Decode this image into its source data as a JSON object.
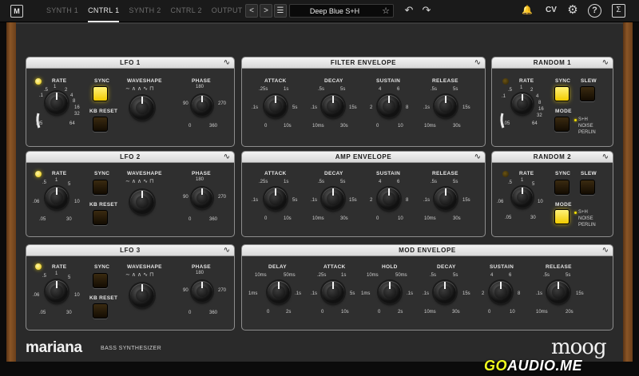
{
  "topbar": {
    "logo": "M",
    "tabs": [
      {
        "label": "SYNTH 1"
      },
      {
        "label": "CNTRL 1"
      },
      {
        "label": "SYNTH 2"
      },
      {
        "label": "CNTRL 2"
      },
      {
        "label": "OUTPUT"
      }
    ],
    "prev": "<",
    "next": ">",
    "menu": "☰",
    "preset": "Deep Blue S+H",
    "star": "☆",
    "undo": "↶",
    "redo": "↷",
    "bell": "🔔",
    "cv": "CV",
    "gear": "⚙",
    "help": "?",
    "sigma": "Σ"
  },
  "panels": {
    "lfo1": {
      "title": "LFO 1",
      "rate": "RATE",
      "sync": "SYNC",
      "waveshape": "WAVESHAPE",
      "phase": "PHASE",
      "kbreset": "KB RESET",
      "rate_ticks": [
        ".05",
        ".1",
        ".5",
        "1",
        "2",
        "4",
        "8",
        "16",
        "32",
        "64"
      ],
      "phase_ticks": [
        "0",
        "90",
        "180",
        "270",
        "360"
      ]
    },
    "lfo2": {
      "title": "LFO 2",
      "rate": "RATE",
      "sync": "SYNC",
      "waveshape": "WAVESHAPE",
      "phase": "PHASE",
      "kbreset": "KB RESET",
      "rate_ticks": [
        ".05",
        ".06",
        ".5",
        "1",
        "5",
        "10",
        "30"
      ],
      "phase_ticks": [
        "0",
        "90",
        "180",
        "270",
        "360"
      ]
    },
    "lfo3": {
      "title": "LFO 3",
      "rate": "RATE",
      "sync": "SYNC",
      "waveshape": "WAVESHAPE",
      "phase": "PHASE",
      "kbreset": "KB RESET",
      "rate_ticks": [
        ".05",
        ".06",
        ".5",
        "1",
        "5",
        "10",
        "30"
      ],
      "phase_ticks": [
        "0",
        "90",
        "180",
        "270",
        "360"
      ]
    },
    "filter_env": {
      "title": "FILTER ENVELOPE",
      "attack": "ATTACK",
      "decay": "DECAY",
      "sustain": "SUSTAIN",
      "release": "RELEASE",
      "attack_ticks": [
        "0",
        ".1s",
        ".25s",
        "1s",
        "5s",
        "10s"
      ],
      "decay_ticks": [
        "10ms",
        ".1s",
        ".5s",
        "5s",
        "15s",
        "30s"
      ],
      "sustain_ticks": [
        "0",
        "2",
        "4",
        "6",
        "8",
        "10"
      ],
      "release_ticks": [
        "10ms",
        ".1s",
        ".5s",
        "5s",
        "15s",
        "30s"
      ]
    },
    "amp_env": {
      "title": "AMP ENVELOPE",
      "attack": "ATTACK",
      "decay": "DECAY",
      "sustain": "SUSTAIN",
      "release": "RELEASE",
      "attack_ticks": [
        "0",
        ".1s",
        ".25s",
        "1s",
        "5s",
        "10s"
      ],
      "decay_ticks": [
        "10ms",
        ".1s",
        ".5s",
        "5s",
        "15s",
        "30s"
      ],
      "sustain_ticks": [
        "0",
        "2",
        "4",
        "6",
        "8",
        "10"
      ],
      "release_ticks": [
        "10ms",
        ".1s",
        ".5s",
        "5s",
        "15s",
        "30s"
      ]
    },
    "mod_env": {
      "title": "MOD ENVELOPE",
      "delay": "DELAY",
      "attack": "ATTACK",
      "hold": "HOLD",
      "decay": "DECAY",
      "sustain": "SUSTAIN",
      "release": "RELEASE",
      "delay_ticks": [
        "0",
        "1ms",
        "10ms",
        "50ms",
        ".1s",
        "2s"
      ],
      "attack_ticks": [
        "0",
        ".1s",
        ".25s",
        "1s",
        "5s",
        "10s"
      ],
      "hold_ticks": [
        "0",
        "1ms",
        "10ms",
        "50ms",
        ".1s",
        "2s"
      ],
      "decay_ticks": [
        "10ms",
        ".1s",
        ".5s",
        "5s",
        "15s",
        "30s"
      ],
      "sustain_ticks": [
        "0",
        "2",
        "4",
        "6",
        "8",
        "10"
      ],
      "release_ticks": [
        "10ms",
        ".1s",
        ".5s",
        "5s",
        "15s",
        "20s"
      ]
    },
    "random1": {
      "title": "RANDOM 1",
      "rate": "RATE",
      "sync": "SYNC",
      "slew": "SLEW",
      "mode": "MODE",
      "modes": [
        "S+H",
        "NOISE",
        "PERLIN"
      ],
      "rate_ticks": [
        ".05",
        ".1",
        ".5",
        "1",
        "2",
        "4",
        "8",
        "16",
        "32",
        "64"
      ]
    },
    "random2": {
      "title": "RANDOM 2",
      "rate": "RATE",
      "sync": "SYNC",
      "slew": "SLEW",
      "mode": "MODE",
      "modes": [
        "S+H",
        "NOISE",
        "PERLIN"
      ],
      "rate_ticks": [
        ".05",
        ".06",
        ".5",
        "1",
        "5",
        "10",
        "30"
      ]
    }
  },
  "footer": {
    "brand": "mariana",
    "subtitle": "BASS SYNTHESIZER",
    "moog": "moog",
    "watermark_a": "GO",
    "watermark_b": "AUDIO.ME"
  },
  "colors": {
    "accent_yellow": "#f5d400",
    "panel_bg": "#2f2f2f",
    "header_bg": "#eaeaea",
    "wood": "#7a4a1f"
  }
}
